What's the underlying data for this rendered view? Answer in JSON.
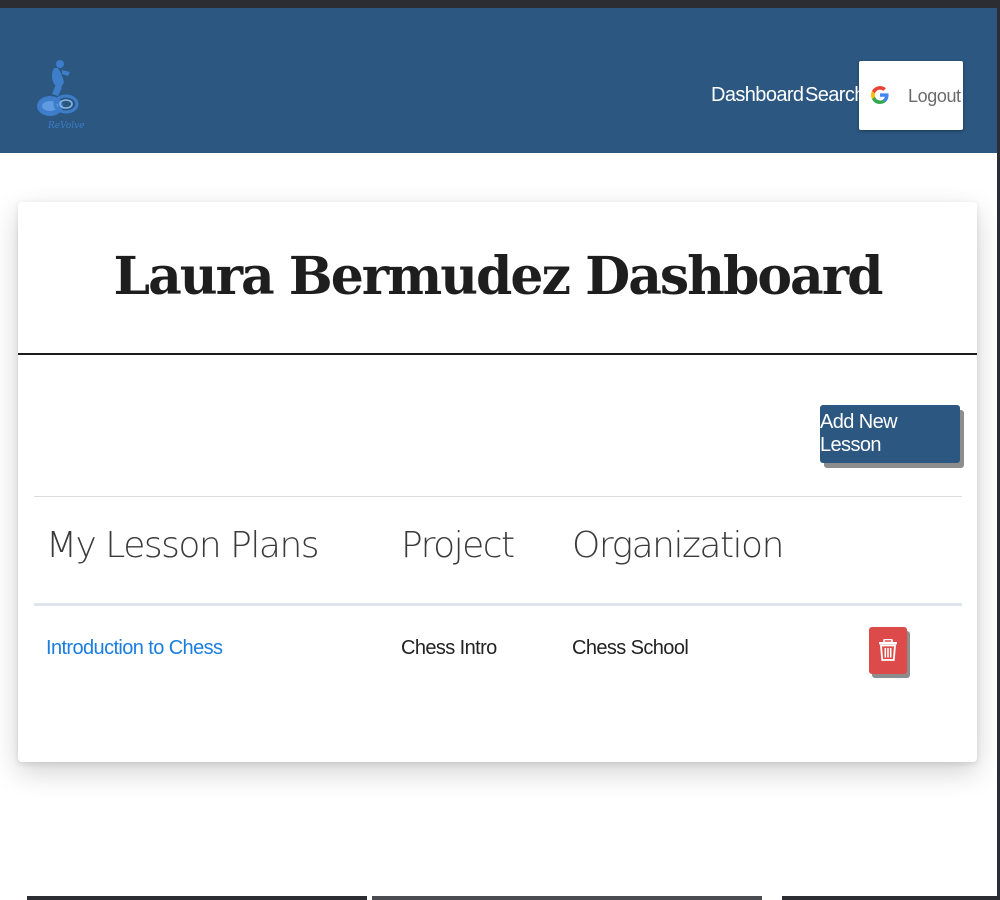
{
  "navbar": {
    "logo_text": "ReVolve",
    "links": [
      {
        "label": "Dashboard"
      },
      {
        "label": "Search"
      }
    ],
    "logout_label": "Logout"
  },
  "dashboard": {
    "title": "Laura Bermudez Dashboard",
    "add_button_label": "Add New Lesson",
    "table": {
      "headers": [
        "My Lesson Plans",
        "Project",
        "Organization"
      ],
      "rows": [
        {
          "lesson": "Introduction to Chess",
          "project": "Chess Intro",
          "organization": "Chess School"
        }
      ]
    }
  },
  "icons": {
    "logo": "revolve-logo-icon",
    "google": "google-g-icon",
    "delete": "trash-icon"
  },
  "colors": {
    "navbar": "#2b5781",
    "primary_button": "#2b5781",
    "danger_button": "#dc4a4a",
    "link": "#1a7de0"
  }
}
